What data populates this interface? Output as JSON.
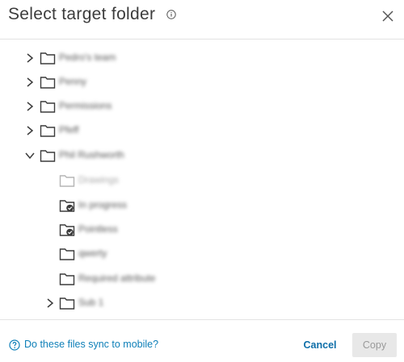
{
  "dialog": {
    "title": "Select target folder"
  },
  "tree": {
    "items": [
      {
        "label": "Pedro's team",
        "expandable": true,
        "expanded": false,
        "icon": "folder-icon",
        "state": "normal"
      },
      {
        "label": "Penny",
        "expandable": true,
        "expanded": false,
        "icon": "folder-icon",
        "state": "normal"
      },
      {
        "label": "Permissions",
        "expandable": true,
        "expanded": false,
        "icon": "folder-icon",
        "state": "normal"
      },
      {
        "label": "Pfeff",
        "expandable": true,
        "expanded": false,
        "icon": "folder-icon",
        "state": "normal"
      },
      {
        "label": "Phil Rushworth",
        "expandable": true,
        "expanded": true,
        "icon": "folder-icon",
        "state": "normal"
      },
      {
        "label": "Drawings",
        "expandable": false,
        "expanded": false,
        "icon": "folder-icon",
        "state": "disabled"
      },
      {
        "label": "In progress",
        "expandable": false,
        "expanded": false,
        "icon": "folder-check-icon",
        "state": "normal"
      },
      {
        "label": "Pointless",
        "expandable": false,
        "expanded": false,
        "icon": "folder-check-icon",
        "state": "normal"
      },
      {
        "label": "qwerty",
        "expandable": false,
        "expanded": false,
        "icon": "folder-icon",
        "state": "normal"
      },
      {
        "label": "Required attribute",
        "expandable": false,
        "expanded": false,
        "icon": "folder-icon",
        "state": "normal"
      },
      {
        "label": "Sub 1",
        "expandable": true,
        "expanded": false,
        "icon": "folder-icon",
        "state": "normal"
      }
    ]
  },
  "footer": {
    "help_link": "Do these files sync to mobile?",
    "cancel_label": "Cancel",
    "copy_label": "Copy"
  },
  "colors": {
    "accent": "#0d7fb8",
    "disabled_bg": "#e8e8e8",
    "disabled_text": "#9a9a9a"
  }
}
